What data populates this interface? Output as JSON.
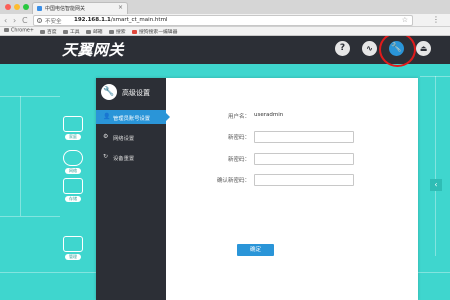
{
  "browser": {
    "tab_title": "中国电信智能网关",
    "tab_close": "×",
    "nav_back": "‹",
    "nav_forward": "›",
    "nav_reload": "C",
    "insecure_label": "不安全",
    "url_host": "192.168.1.1",
    "url_path": "/smart_ct_main.html",
    "bookmarks": [
      "Chrome+",
      "百度",
      "工具",
      "邮箱",
      "搜索",
      "搜狗搜索—编辑器"
    ]
  },
  "header": {
    "logo_text": "天翼网关",
    "icons": [
      "help-icon",
      "pulse-icon",
      "wrench-icon",
      "exit-icon"
    ]
  },
  "left_nav": [
    "家庭",
    "网络",
    "存储",
    "管理"
  ],
  "settings": {
    "title": "高级设置",
    "menu": [
      {
        "label": "管理员账号设置",
        "icon": "user-icon",
        "active": true
      },
      {
        "label": "网络设置",
        "icon": "gear-icon",
        "active": false
      },
      {
        "label": "设备重置",
        "icon": "reset-icon",
        "active": false
      }
    ],
    "form": {
      "username_label": "用户名：",
      "username_value": "useradmin",
      "new_password_label": "新密码：",
      "new_password2_label": "新密码：",
      "confirm_password_label": "确认新密码：",
      "submit_label": "确定"
    }
  },
  "colors": {
    "page_bg": "#3fd6ce",
    "header_bg": "#2c2f36",
    "accent": "#2a95d8",
    "highlight_circle": "#e01b1b"
  }
}
